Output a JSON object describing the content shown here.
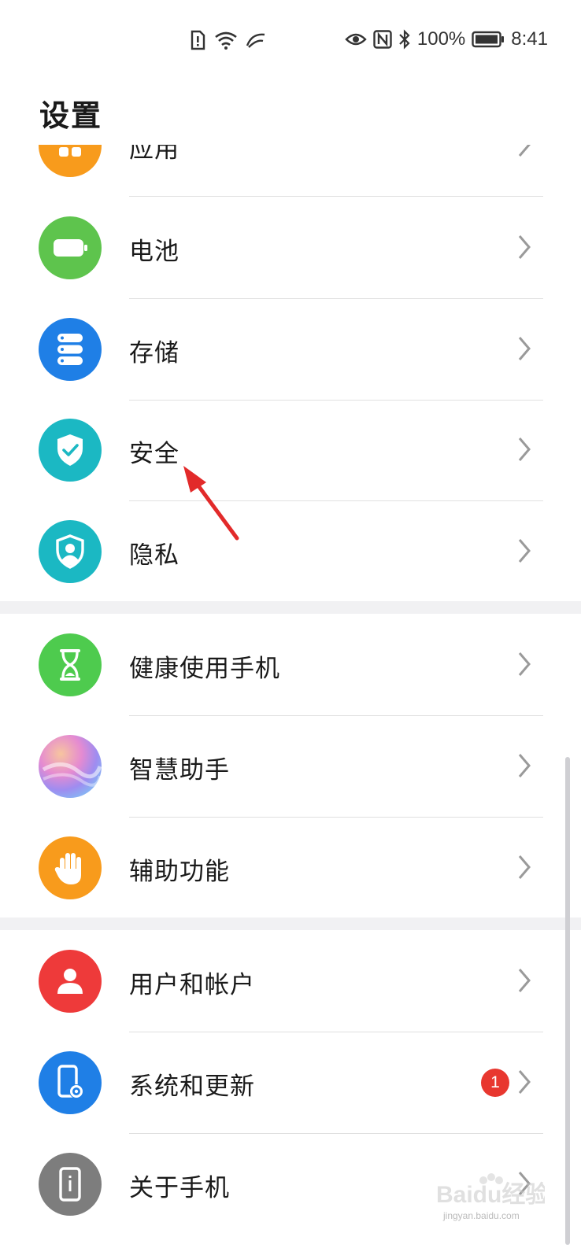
{
  "status_bar": {
    "battery_percent": "100%",
    "time": "8:41"
  },
  "header": {
    "title": "设置"
  },
  "rows": [
    {
      "label": "应用"
    },
    {
      "label": "电池"
    },
    {
      "label": "存储"
    },
    {
      "label": "安全"
    },
    {
      "label": "隐私"
    },
    {
      "label": "健康使用手机"
    },
    {
      "label": "智慧助手"
    },
    {
      "label": "辅助功能"
    },
    {
      "label": "用户和帐户"
    },
    {
      "label": "系统和更新",
      "badge": "1"
    },
    {
      "label": "关于手机"
    }
  ],
  "icon_names": [
    "apps-icon",
    "battery-icon",
    "storage-icon",
    "security-shield-icon",
    "privacy-icon",
    "hourglass-icon",
    "smart-assistant-icon",
    "hand-icon",
    "user-icon",
    "phone-gear-icon",
    "phone-info-icon"
  ],
  "colors": {
    "orange": "#f89b1c",
    "green": "#5ec44d",
    "blue": "#1f7fe6",
    "teal": "#1bb8c3",
    "red": "#ee3a3a",
    "gray": "#7d7d7d",
    "badge": "#e8372f"
  },
  "watermark": {
    "text": "Baidu经验",
    "url_text": "jingyan.baidu.com"
  }
}
